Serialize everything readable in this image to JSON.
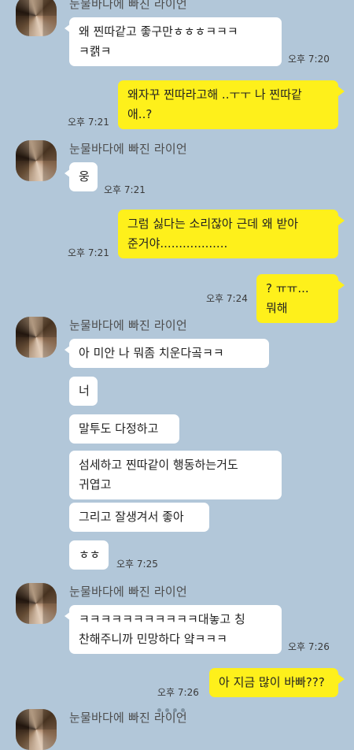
{
  "contact": {
    "name": "눈물바다에 빠진 라이언"
  },
  "messages": [
    {
      "id": "m1",
      "side": "left",
      "text": "왜 찐따같고 좋구만ㅎㅎㅎㅋㅋㅋ\nㅋ캙ㅋ",
      "time": "오후 7:20"
    },
    {
      "id": "m2",
      "side": "right",
      "text": "왜자꾸 찐따라고해 ..ㅜㅜ 나 찐따같\n애..?",
      "time": "오후 7:21"
    },
    {
      "id": "m3",
      "side": "left",
      "text": "웅",
      "time": "오후 7:21"
    },
    {
      "id": "m4",
      "side": "right",
      "text": "그럼 싫다는 소리잖아 근데 왜 받아\n준거야..................",
      "time": "오후 7:21"
    },
    {
      "id": "m5",
      "side": "right",
      "text": "? ㅠㅠ... 뭐해",
      "time": "오후 7:24"
    },
    {
      "id": "m6",
      "side": "left",
      "text": "아 미안 나 뭐좀 치운다곸ㅋㅋ",
      "time": ""
    },
    {
      "id": "m7",
      "side": "left",
      "text": "너",
      "time": ""
    },
    {
      "id": "m8",
      "side": "left",
      "text": "말투도 다정하고",
      "time": ""
    },
    {
      "id": "m9",
      "side": "left",
      "text": "섬세하고 찐따같이 행동하는거도\n귀엽고",
      "time": ""
    },
    {
      "id": "m10",
      "side": "left",
      "text": "그리고 잘생겨서 좋아",
      "time": ""
    },
    {
      "id": "m11",
      "side": "left",
      "text": "ㅎㅎ",
      "time": "오후 7:25"
    },
    {
      "id": "m12",
      "side": "left",
      "text": "ㅋㅋㅋㅋㅋㅋㅋㅋㅋㅋㅋ대놓고 칭\n찬해주니까 민망하다 얔ㅋㅋㅋ",
      "time": "오후 7:26"
    },
    {
      "id": "m13",
      "side": "right",
      "text": "아 지금 많이 바빠???",
      "time": "오후 7:26"
    }
  ]
}
